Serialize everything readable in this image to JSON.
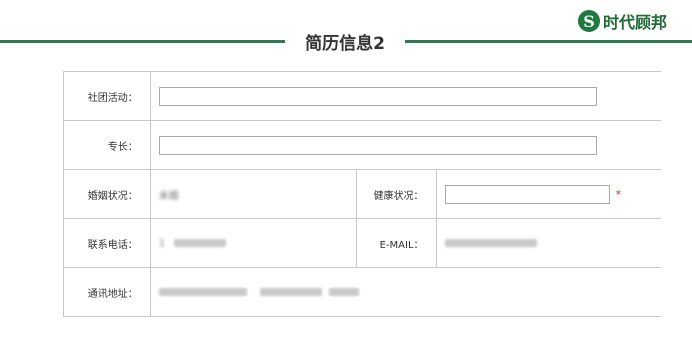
{
  "brand": {
    "logo_mark": "S",
    "name": "时代顾邦"
  },
  "header": {
    "title": "简历信息2"
  },
  "form": {
    "club_activities_label": "社团活动：",
    "specialty_label": "专长：",
    "marital_status_label": "婚姻状况：",
    "marital_status_value": "未婚",
    "health_status_label": "健康状况：",
    "required_mark": "*",
    "phone_label": "联系电话：",
    "phone_value": "1",
    "email_label": "E-MAIL：",
    "address_label": "通讯地址："
  }
}
